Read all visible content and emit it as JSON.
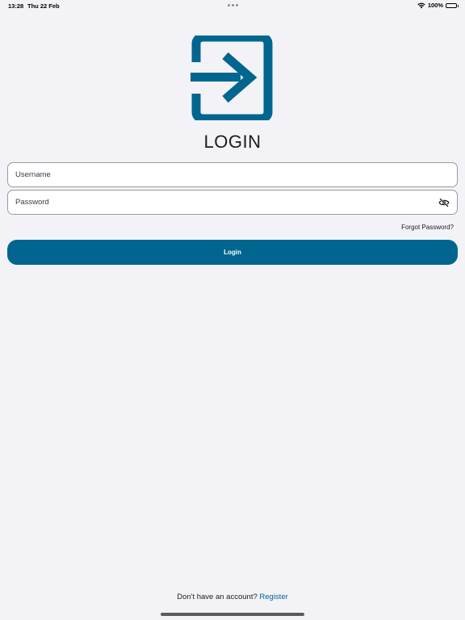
{
  "status_bar": {
    "time": "13:28",
    "date": "Thu 22 Feb",
    "battery": "100%",
    "battery_level": 1.0
  },
  "brand": {
    "accent_color": "#00668f",
    "logo_icon": "login-arrow-icon"
  },
  "page": {
    "title": "LOGIN"
  },
  "form": {
    "username_placeholder": "Username",
    "username_value": "",
    "password_placeholder": "Password",
    "password_value": "",
    "password_toggle_icon": "eye-off-icon",
    "forgot_password": "Forgot Password?",
    "login_label": "Login"
  },
  "footer": {
    "prompt": "Don't have an account?",
    "register_label": "Register"
  }
}
